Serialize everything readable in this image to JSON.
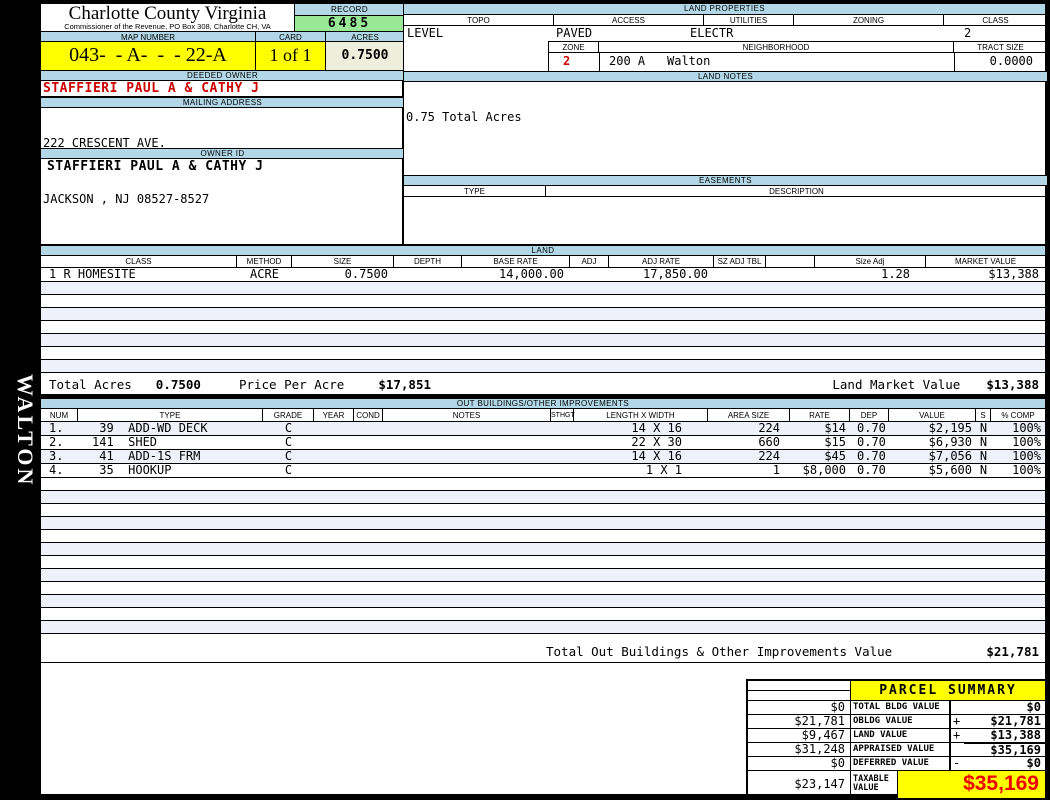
{
  "sidebar": {
    "district": "WALTON"
  },
  "header": {
    "county": "Charlotte County Virginia",
    "commissioner": "Commissioner of the Revenue, PO Box 308, Charlotte CH, VA",
    "record_label": "RECORD",
    "record_value": "6485",
    "map_number_label": "MAP NUMBER",
    "map_number": "043-  - A-  -  - 22-A",
    "card_label": "CARD",
    "card": "1 of 1",
    "acres_label": "ACRES",
    "acres": "0.7500"
  },
  "owner": {
    "deeded_owner_label": "DEEDED OWNER",
    "deeded_owner": "STAFFIERI PAUL A & CATHY J",
    "mailing_address_label": "MAILING ADDRESS",
    "address_line1": "222 CRESCENT AVE.",
    "address_line2": "JACKSON , NJ 08527-8527",
    "owner_id_label": "OWNER ID",
    "owner_id": "STAFFIERI PAUL A & CATHY J"
  },
  "land_properties": {
    "title": "LAND PROPERTIES",
    "topo_label": "TOPO",
    "topo": "LEVEL",
    "access_label": "ACCESS",
    "access": "PAVED",
    "utilities_label": "UTILITIES",
    "utilities": "ELECTR",
    "zoning_label": "ZONING",
    "zoning": "",
    "class_label": "CLASS",
    "class": "2",
    "zone_label": "ZONE",
    "zone": "2",
    "neighborhood_label": "NEIGHBORHOOD",
    "neighborhood_code": "200 A",
    "neighborhood": "Walton",
    "tract_size_label": "TRACT SIZE",
    "tract_size": "0.0000"
  },
  "land_notes": {
    "title": "LAND NOTES",
    "note": "0.75 Total Acres"
  },
  "easements": {
    "title": "EASEMENTS",
    "type_label": "TYPE",
    "description_label": "DESCRIPTION"
  },
  "land": {
    "title": "LAND",
    "headers": [
      "CLASS",
      "METHOD",
      "SIZE",
      "DEPTH",
      "BASE RATE",
      "ADJ",
      "ADJ RATE",
      "SZ ADJ TBL",
      "",
      "Size Adj",
      "MARKET VALUE"
    ],
    "rows": [
      {
        "class": "1 R HOMESITE",
        "method": "ACRE",
        "size": "0.7500",
        "depth": "",
        "base_rate": "14,000.00",
        "adj": "",
        "adj_rate": "17,850.00",
        "sz_adj_tbl": "",
        "blank": "",
        "size_adj": "1.28",
        "market_value": "$13,388"
      }
    ],
    "totals": {
      "total_acres_label": "Total Acres",
      "total_acres": "0.7500",
      "price_per_acre_label": "Price Per Acre",
      "price_per_acre": "$17,851",
      "market_value_label": "Land Market Value",
      "market_value": "$13,388"
    }
  },
  "outbuildings": {
    "title": "OUT BUILDINGS/OTHER IMPROVEMENTS",
    "headers": [
      "NUM",
      "TYPE",
      "GRADE",
      "YEAR",
      "COND",
      "NOTES",
      "STHGT",
      "LENGTH X WIDTH",
      "AREA SIZE",
      "RATE",
      "DEP",
      "VALUE",
      "S",
      "% COMP"
    ],
    "rows": [
      {
        "num": "1.",
        "type": " 39  ADD-WD DECK",
        "grade": "C",
        "year": "",
        "cond": "",
        "notes": "",
        "sthgt": "",
        "dims": "14 X 16",
        "area": "224",
        "rate": "$14",
        "dep": "0.70",
        "value": "$2,195",
        "s": "N",
        "comp": "100%"
      },
      {
        "num": "2.",
        "type": "141  SHED",
        "grade": "C",
        "year": "",
        "cond": "",
        "notes": "",
        "sthgt": "",
        "dims": "22 X 30",
        "area": "660",
        "rate": "$15",
        "dep": "0.70",
        "value": "$6,930",
        "s": "N",
        "comp": "100%"
      },
      {
        "num": "3.",
        "type": " 41  ADD-1S FRM",
        "grade": "C",
        "year": "",
        "cond": "",
        "notes": "",
        "sthgt": "",
        "dims": "14 X 16",
        "area": "224",
        "rate": "$45",
        "dep": "0.70",
        "value": "$7,056",
        "s": "N",
        "comp": "100%"
      },
      {
        "num": "4.",
        "type": " 35  HOOKUP",
        "grade": "C",
        "year": "",
        "cond": "",
        "notes": "",
        "sthgt": "",
        "dims": "1 X 1",
        "area": "1",
        "rate": "$8,000",
        "dep": "0.70",
        "value": "$5,600",
        "s": "N",
        "comp": "100%"
      }
    ],
    "total_label": "Total Out Buildings & Other Improvements Value",
    "total_value": "$21,781"
  },
  "parcel_summary": {
    "title": "PARCEL SUMMARY",
    "rows": [
      {
        "prior": "$0",
        "label": "TOTAL BLDG VALUE",
        "op": "",
        "value": "$0"
      },
      {
        "prior": "$21,781",
        "label": "OBLDG VALUE",
        "op": "+",
        "value": "$21,781"
      },
      {
        "prior": "$9,467",
        "label": "LAND VALUE",
        "op": "+",
        "value": "$13,388"
      },
      {
        "prior": "$31,248",
        "label": "APPRAISED VALUE",
        "op": "",
        "value": "$35,169"
      },
      {
        "prior": "$0",
        "label": "DEFERRED VALUE",
        "op": "-",
        "value": "$0"
      }
    ],
    "taxable": {
      "prior": "$23,147",
      "label": "TAXABLE VALUE",
      "value": "$35,169"
    }
  },
  "colors": {
    "section_header": "#b2d8e8",
    "record_value_bg": "#98e898",
    "highlight_yellow": "#ffff00",
    "acres_bg": "#eeeedd",
    "owner_red": "#cc0000",
    "taxable_red": "#ee0000",
    "stripe_blue": "#eef1f9",
    "page_bg": "#000000"
  }
}
